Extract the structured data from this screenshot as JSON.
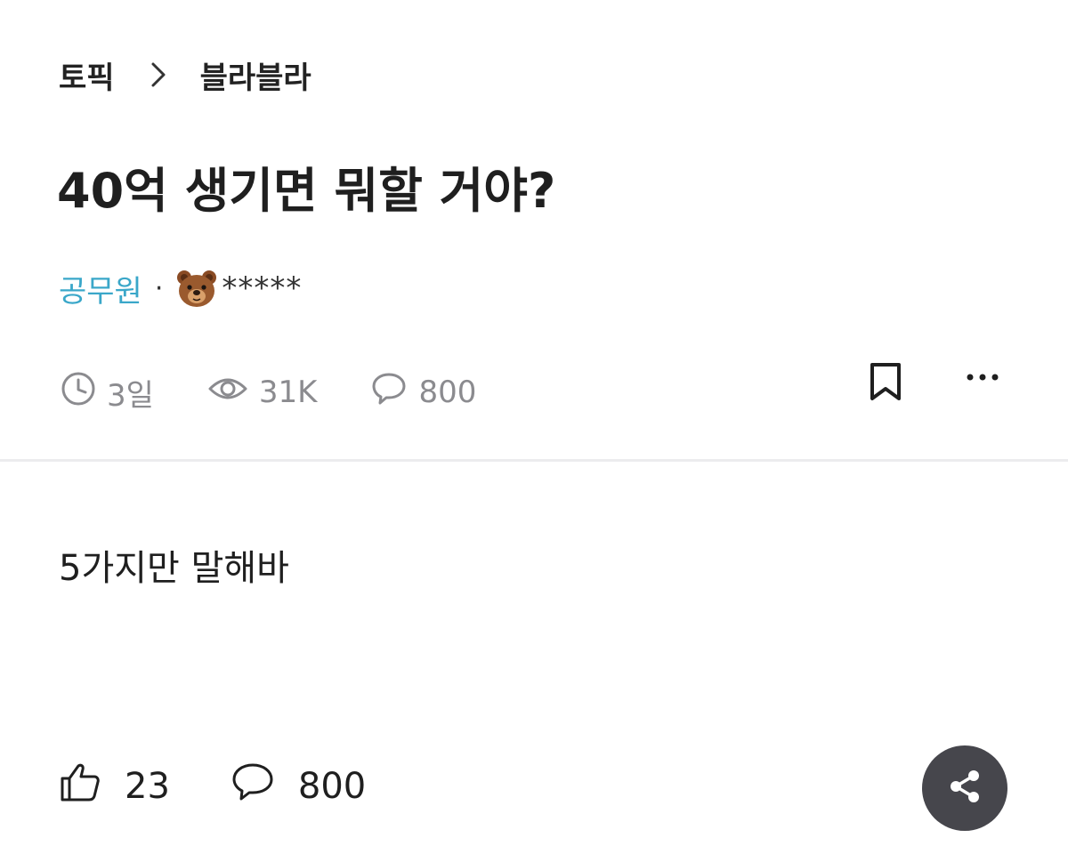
{
  "breadcrumb": {
    "section": "토픽",
    "topic": "블라블라"
  },
  "post": {
    "title": "40억 생기면 뭐할 거야?",
    "author": {
      "company": "공무원",
      "separator": "·",
      "avatar_icon": "bear-face-icon",
      "nickname": "*****"
    },
    "meta": {
      "time": "3일",
      "views": "31K",
      "comments": "800"
    },
    "body": "5가지만 말해바",
    "reactions": {
      "likes": "23",
      "comments": "800"
    }
  },
  "icons": {
    "breadcrumb_sep": "chevron-right-icon",
    "time": "clock-icon",
    "views": "eye-icon",
    "comments": "comment-icon",
    "bookmark": "bookmark-icon",
    "more": "more-horizontal-icon",
    "like": "thumbs-up-icon",
    "share": "share-icon"
  },
  "colors": {
    "company": "#3aa7c9",
    "meta": "#8b8b8f",
    "share_button_bg": "#46464c"
  }
}
